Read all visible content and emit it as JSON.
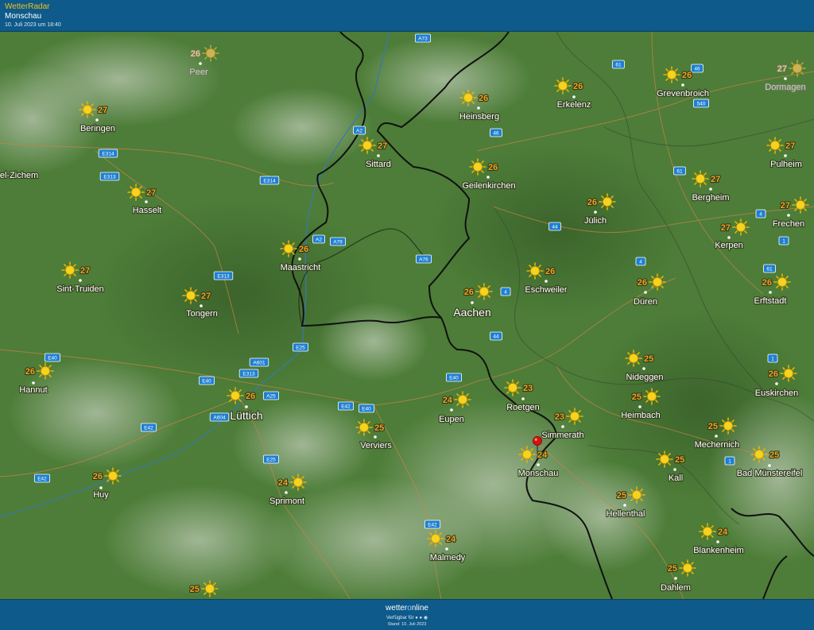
{
  "header": {
    "app_title": "WetterRadar",
    "location": "Monschau",
    "date": "10. Juli 2023 um 18:40"
  },
  "footer": {
    "brand_left": "wetter",
    "brand_mid": "o",
    "brand_right": "nline",
    "available": "Verfügbar für",
    "available_icons": [
      "apple-icon",
      "android-icon",
      "web-icon"
    ],
    "stand": "Stand: 10. Juli 2023"
  },
  "colors": {
    "header_bg": "#0e5a8a",
    "land": "#4a7a35",
    "border": "#111111",
    "temperature": "#f2a21c",
    "sun": "#f7d21e",
    "road_badge": "#1f7fd1",
    "location_pin": "#e01010"
  },
  "marker": {
    "name": "Monschau",
    "icon": "map-pin-icon"
  },
  "cities": [
    {
      "name": "Peer",
      "temp": "26",
      "faded": true
    },
    {
      "name": "Beringen",
      "temp": "27"
    },
    {
      "name": "el-Zichem",
      "temp": ""
    },
    {
      "name": "Hasselt",
      "temp": "27"
    },
    {
      "name": "Sint-Truiden",
      "temp": "27"
    },
    {
      "name": "Tongern",
      "temp": "27"
    },
    {
      "name": "Hannut",
      "temp": "26"
    },
    {
      "name": "Huy",
      "temp": "26"
    },
    {
      "name": "Lüttich",
      "temp": "26",
      "big": true
    },
    {
      "name": "Sprimont",
      "temp": "24"
    },
    {
      "name": "Verviers",
      "temp": "25"
    },
    {
      "name": "Malmedy",
      "temp": "24"
    },
    {
      "name": "Maastricht",
      "temp": "26"
    },
    {
      "name": "Sittard",
      "temp": "27"
    },
    {
      "name": "Heinsberg",
      "temp": "26"
    },
    {
      "name": "Erkelenz",
      "temp": "26"
    },
    {
      "name": "Grevenbroich",
      "temp": "26"
    },
    {
      "name": "Dormagen",
      "temp": "27",
      "faded": true
    },
    {
      "name": "Geilenkirchen",
      "temp": "26"
    },
    {
      "name": "Jülich",
      "temp": "26"
    },
    {
      "name": "Bergheim",
      "temp": "27"
    },
    {
      "name": "Pulheim",
      "temp": "27"
    },
    {
      "name": "Frechen",
      "temp": "27"
    },
    {
      "name": "Kerpen",
      "temp": "27"
    },
    {
      "name": "Aachen",
      "temp": "26",
      "big": true
    },
    {
      "name": "Eschweiler",
      "temp": "26"
    },
    {
      "name": "Düren",
      "temp": "26"
    },
    {
      "name": "Erftstadt",
      "temp": "26"
    },
    {
      "name": "Eupen",
      "temp": "24"
    },
    {
      "name": "Roetgen",
      "temp": "23"
    },
    {
      "name": "Nideggen",
      "temp": "25"
    },
    {
      "name": "Euskirchen",
      "temp": "26"
    },
    {
      "name": "Heimbach",
      "temp": "25"
    },
    {
      "name": "Simmerath",
      "temp": "23"
    },
    {
      "name": "Monschau",
      "temp": "24"
    },
    {
      "name": "Mechernich",
      "temp": "25"
    },
    {
      "name": "Kall",
      "temp": "25"
    },
    {
      "name": "Bad Münstereifel",
      "temp": "25"
    },
    {
      "name": "Hellenthal",
      "temp": "25"
    },
    {
      "name": "Blankenheim",
      "temp": "24"
    },
    {
      "name": "Dahlem",
      "temp": "25"
    },
    {
      "name": "",
      "temp": "25"
    }
  ],
  "roads": [
    "A73",
    "61",
    "46",
    "540",
    "A2",
    "46",
    "E314",
    "E313",
    "E314",
    "61",
    "4",
    "1",
    "A2",
    "A79",
    "44",
    "A76",
    "61",
    "4",
    "E313",
    "4",
    "E40",
    "E25",
    "A601",
    "44",
    "1",
    "E313",
    "E40",
    "A25",
    "E40",
    "E42",
    "E40",
    "A604",
    "E42",
    "E42",
    "E25",
    "1",
    "E42"
  ]
}
